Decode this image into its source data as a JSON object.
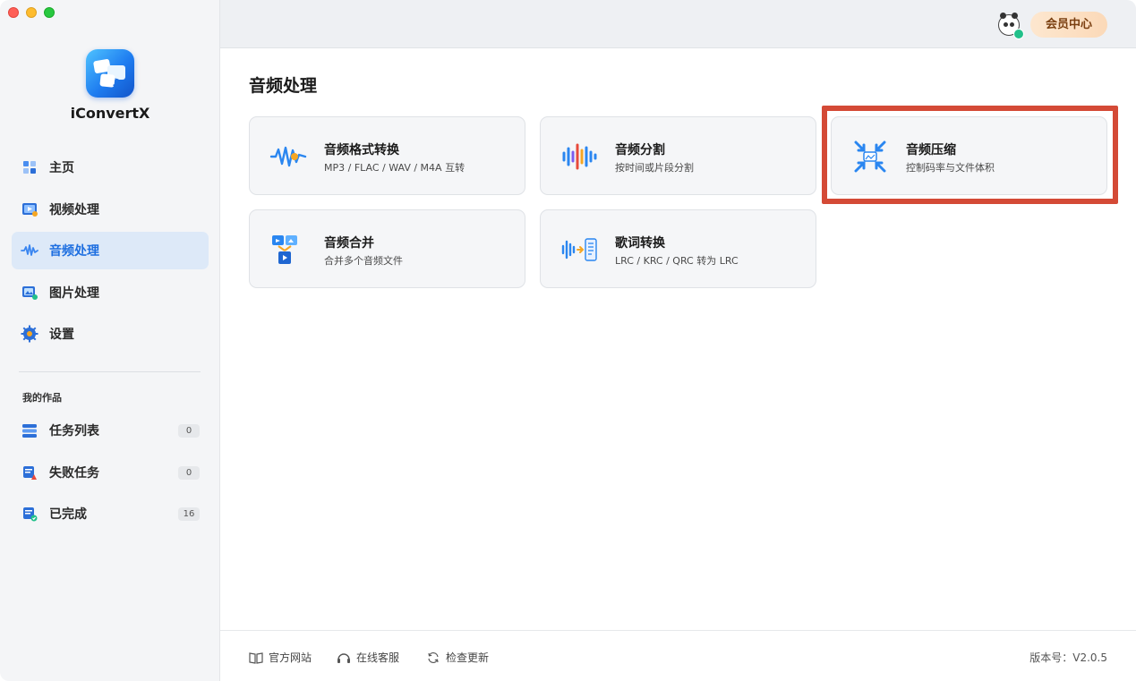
{
  "app": {
    "name": "iConvertX"
  },
  "header": {
    "vip_label": "会员中心"
  },
  "sidebar": {
    "nav": [
      {
        "label": "主页",
        "icon": "home-icon"
      },
      {
        "label": "视频处理",
        "icon": "video-icon"
      },
      {
        "label": "音频处理",
        "icon": "audio-wave-icon",
        "active": true
      },
      {
        "label": "图片处理",
        "icon": "image-icon"
      },
      {
        "label": "设置",
        "icon": "gear-icon"
      }
    ],
    "section_label": "我的作品",
    "works": [
      {
        "label": "任务列表",
        "count": "0",
        "icon": "task-list-icon"
      },
      {
        "label": "失败任务",
        "count": "0",
        "icon": "failed-task-icon"
      },
      {
        "label": "已完成",
        "count": "16",
        "icon": "completed-icon"
      }
    ]
  },
  "main": {
    "title": "音频处理",
    "cards": [
      {
        "title": "音频格式转换",
        "subtitle": "MP3 / FLAC / WAV / M4A 互转",
        "icon": "audio-convert-icon"
      },
      {
        "title": "音频分割",
        "subtitle": "按时间或片段分割",
        "icon": "audio-split-icon"
      },
      {
        "title": "音频压缩",
        "subtitle": "控制码率与文件体积",
        "icon": "audio-compress-icon"
      },
      {
        "title": "音频合并",
        "subtitle": "合并多个音频文件",
        "icon": "audio-merge-icon"
      },
      {
        "title": "歌词转换",
        "subtitle": "LRC / KRC / QRC 转为 LRC",
        "icon": "lyrics-convert-icon"
      }
    ]
  },
  "footer": {
    "links": [
      {
        "label": "官方网站",
        "icon": "book-icon"
      },
      {
        "label": "在线客服",
        "icon": "headset-icon"
      },
      {
        "label": "检查更新",
        "icon": "refresh-icon"
      }
    ],
    "version": "版本号：V2.0.5"
  },
  "colors": {
    "accent": "#1e6fe0",
    "highlight_box": "#d44a36",
    "vip_text": "#7a3f10"
  }
}
